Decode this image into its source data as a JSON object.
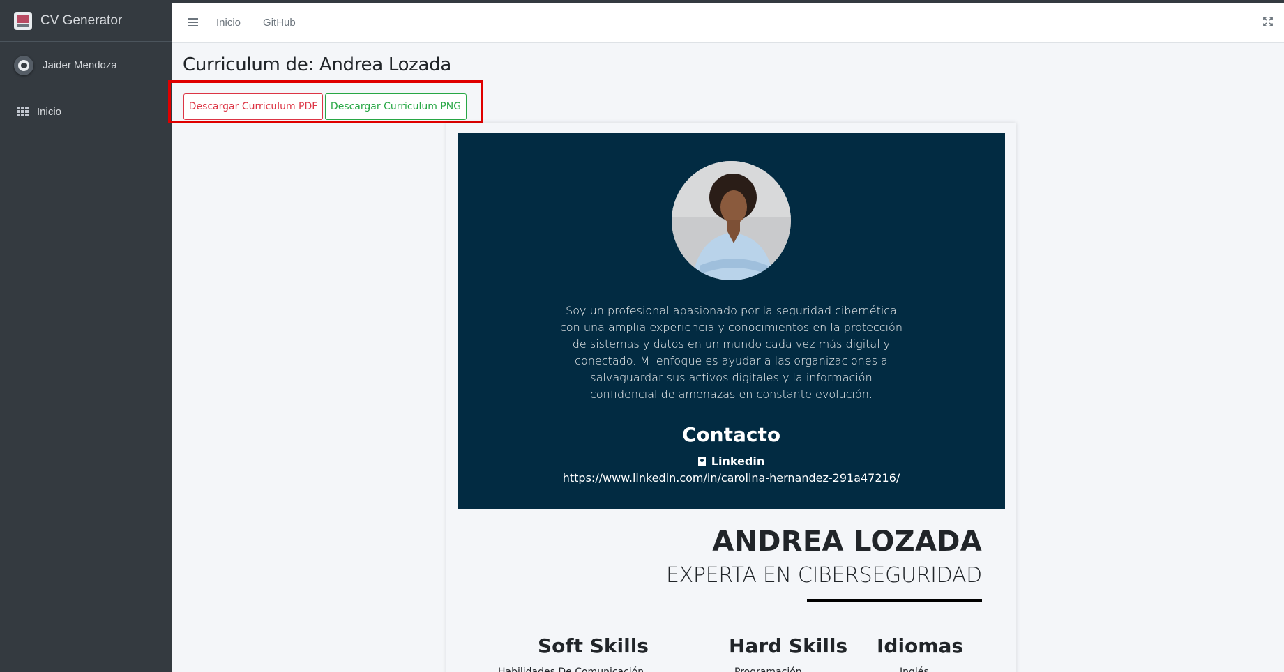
{
  "sidebar": {
    "brand": "CV Generator",
    "user": "Jaider Mendoza",
    "items": [
      {
        "label": "Inicio",
        "icon": "grid-icon"
      }
    ]
  },
  "navbar": {
    "links": [
      "Inicio",
      "GitHub"
    ]
  },
  "page": {
    "title": "Curriculum de: Andrea Lozada",
    "buttons": {
      "pdf": "Descargar Curriculum PDF",
      "png": "Descargar Curriculum PNG"
    }
  },
  "cv": {
    "about": "Soy un profesional apasionado por la seguridad cibernética con una amplia experiencia y conocimientos en la protección de sistemas y datos en un mundo cada vez más digital y conectado. Mi enfoque es ayudar a las organizaciones a salvaguardar sus activos digitales y la información confidencial de amenazas en constante evolución.",
    "contact_title": "Contacto",
    "linkedin_label": "Linkedin",
    "linkedin_url": "https://www.linkedin.com/in/carolina-hernandez-291a47216/",
    "name": "ANDREA LOZADA",
    "role": "EXPERTA EN CIBERSEGURIDAD",
    "sections": {
      "soft": {
        "title": "Soft Skills",
        "first_item": "Habilidades De Comunicación"
      },
      "hard": {
        "title": "Hard Skills",
        "first_item": "Programación"
      },
      "languages": {
        "title": "Idiomas",
        "first_item": "Inglés"
      }
    }
  },
  "colors": {
    "sidebar": "#343a40",
    "cv_header": "#022b42",
    "pdf_button": "#dc3545",
    "png_button": "#28a745",
    "highlight": "#e00000"
  }
}
